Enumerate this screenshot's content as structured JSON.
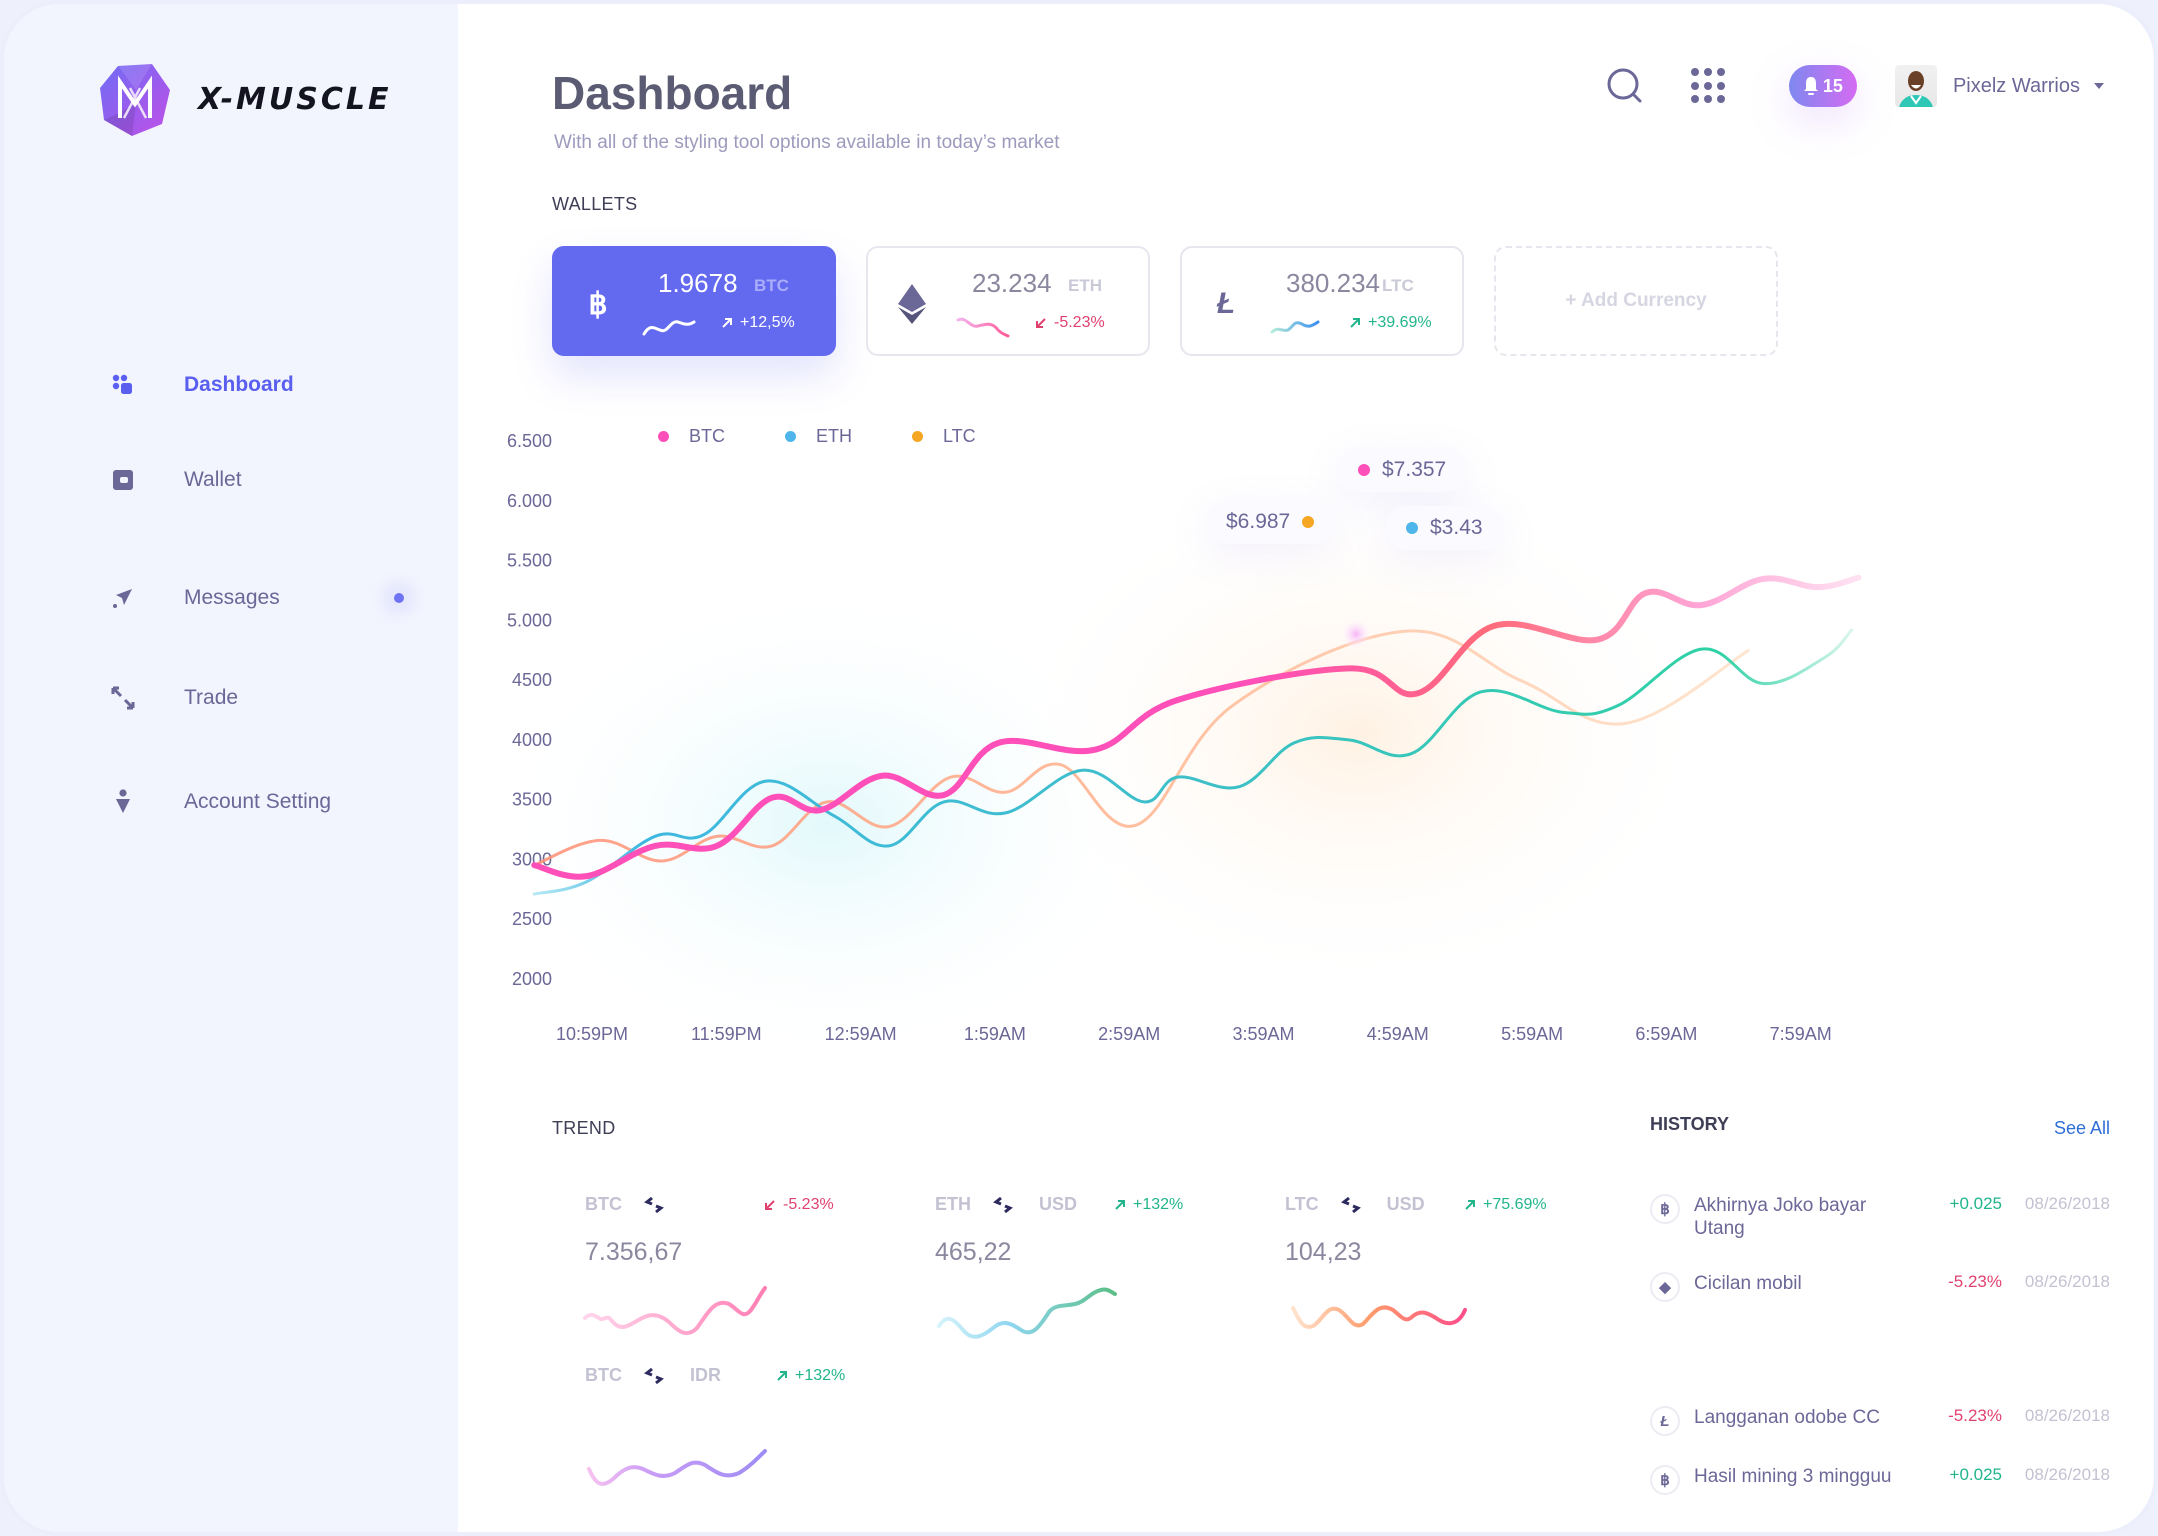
{
  "app": {
    "brand": "X-MUSCLE",
    "colors": {
      "accent": "#636af0",
      "btc": "#ff4fb8",
      "eth": "#4fb6ec",
      "ltc": "#f5a623",
      "positive": "#22b58b",
      "negative": "#e1416f"
    }
  },
  "sidebar": {
    "items": [
      {
        "label": "Dashboard",
        "icon": "dashboard-icon",
        "active": true
      },
      {
        "label": "Wallet",
        "icon": "wallet-icon",
        "active": false
      },
      {
        "label": "Messages",
        "icon": "send-icon",
        "active": false,
        "has_notification_dot": true
      },
      {
        "label": "Trade",
        "icon": "trade-arrows-icon",
        "active": false
      },
      {
        "label": "Account Setting",
        "icon": "account-icon",
        "active": false
      }
    ]
  },
  "header": {
    "title": "Dashboard",
    "subtitle": "With all of the styling tool options available in today’s market",
    "notifications_count": "15",
    "user_name": "Pixelz Warrios"
  },
  "wallets": {
    "label": "WALLETS",
    "cards": [
      {
        "symbol": "BTC",
        "icon": "bitcoin-icon",
        "glyph": "฿",
        "amount": "1.9678",
        "change": "+12,5%",
        "direction": "up"
      },
      {
        "symbol": "ETH",
        "icon": "ethereum-icon",
        "glyph": "◆",
        "amount": "23.234",
        "change": "-5.23%",
        "direction": "down"
      },
      {
        "symbol": "LTC",
        "icon": "litecoin-icon",
        "glyph": "Ł",
        "amount": "380.234",
        "change": "+39.69%",
        "direction": "up"
      }
    ],
    "add_label": "+ Add Currency"
  },
  "chart_data": {
    "type": "line",
    "title": "",
    "xlabel": "",
    "ylabel": "",
    "x": [
      "10:59PM",
      "11:59PM",
      "12:59AM",
      "1:59AM",
      "2:59AM",
      "3:59AM",
      "4:59AM",
      "5:59AM",
      "6:59AM",
      "7:59AM"
    ],
    "y_ticks": [
      "6.500",
      "6.000",
      "5.500",
      "5.000",
      "4500",
      "4000",
      "3500",
      "3000",
      "2500",
      "2000"
    ],
    "y_tick_values": [
      6500,
      6000,
      5500,
      5000,
      4500,
      4000,
      3500,
      3000,
      2500,
      2000
    ],
    "ylim": [
      2000,
      6500
    ],
    "grid": false,
    "legend": {
      "placement": "top-left",
      "entries": [
        "BTC",
        "ETH",
        "LTC"
      ]
    },
    "series": [
      {
        "name": "BTC",
        "color": "#ff4fb8",
        "x_hours": [
          -0.43,
          -0.04,
          0.47,
          0.93,
          1.34,
          1.7,
          2.16,
          2.62,
          3.03,
          3.75,
          4.36,
          5.64,
          6.15,
          6.72,
          7.49,
          7.85,
          8.26,
          8.72,
          9.13,
          9.43
        ],
        "values": [
          2944,
          2852,
          3105,
          3105,
          3508,
          3404,
          3692,
          3531,
          3968,
          3911,
          4325,
          4590,
          4382,
          4946,
          4831,
          5222,
          5119,
          5338,
          5269,
          5349
        ]
      },
      {
        "name": "ETH",
        "color": "#4fb6ec",
        "x_hours": [
          -0.43,
          -0.04,
          0.47,
          0.83,
          1.29,
          1.8,
          2.21,
          2.62,
          3.08,
          3.65,
          4.11,
          4.36,
          4.82,
          5.23,
          5.64,
          6.1,
          6.62,
          7.23,
          7.64,
          8.26,
          8.72,
          9.18,
          9.38
        ],
        "values": [
          2702,
          2805,
          3185,
          3197,
          3646,
          3358,
          3105,
          3473,
          3381,
          3738,
          3473,
          3680,
          3600,
          3968,
          3991,
          3876,
          4394,
          4222,
          4279,
          4751,
          4463,
          4682,
          4912
        ]
      },
      {
        "name": "LTC",
        "color": "#f5a623",
        "x_hours": [
          -0.43,
          0.06,
          0.52,
          0.93,
          1.34,
          1.75,
          2.21,
          2.67,
          3.08,
          3.49,
          4.05,
          4.77,
          6.05,
          6.92,
          7.69,
          8.61
        ],
        "values": [
          2944,
          3151,
          2979,
          3185,
          3105,
          3473,
          3266,
          3680,
          3554,
          3784,
          3278,
          4279,
          4900,
          4486,
          4129,
          4739
        ]
      }
    ],
    "annotations": [
      {
        "series": "BTC",
        "label": "$7.357"
      },
      {
        "series": "LTC",
        "label": "$6.987"
      },
      {
        "series": "ETH",
        "label": "$3.43"
      }
    ]
  },
  "trend": {
    "label": "TREND",
    "cards": [
      {
        "from": "BTC",
        "to": "",
        "value": "7.356,67",
        "change": "-5.23%",
        "direction": "down",
        "gradient": [
          "#ffd0ea",
          "#ff7eb3"
        ]
      },
      {
        "from": "ETH",
        "to": "USD",
        "value": "465,22",
        "change": "+132%",
        "direction": "up",
        "gradient": [
          "#a9def7",
          "#5bc38b"
        ]
      },
      {
        "from": "LTC",
        "to": "USD",
        "value": "104,23",
        "change": "+75.69%",
        "direction": "up",
        "gradient": [
          "#ffd3b0",
          "#ff5c8d"
        ]
      },
      {
        "from": "BTC",
        "to": "IDR",
        "value": "",
        "change": "+132%",
        "direction": "up",
        "gradient": [
          "#f3b9f0",
          "#9c8cf5"
        ]
      }
    ]
  },
  "history": {
    "label": "HISTORY",
    "see_all": "See All",
    "items": [
      {
        "icon": "bitcoin-icon",
        "glyph": "฿",
        "name": "Akhirnya Joko bayar Utang",
        "amount": "+0.025",
        "direction": "up",
        "date": "08/26/2018"
      },
      {
        "icon": "ethereum-icon",
        "glyph": "◆",
        "name": "Cicilan mobil",
        "amount": "-5.23%",
        "direction": "down",
        "date": "08/26/2018"
      },
      {
        "icon": "litecoin-icon",
        "glyph": "Ł",
        "name": "Langganan odobe CC",
        "amount": "-5.23%",
        "direction": "down",
        "date": "08/26/2018"
      },
      {
        "icon": "bitcoin-icon",
        "glyph": "฿",
        "name": "Hasil mining 3 mingguu",
        "amount": "+0.025",
        "direction": "up",
        "date": "08/26/2018"
      }
    ]
  }
}
